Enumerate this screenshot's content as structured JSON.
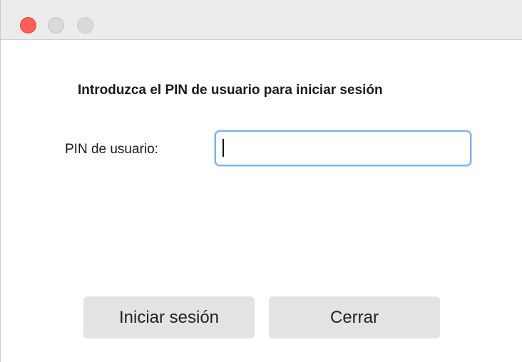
{
  "window": {
    "traffic_lights": {
      "close_color": "#fe5f57",
      "minimize_color": "#d9d9d9",
      "zoom_color": "#d9d9d9"
    }
  },
  "dialog": {
    "heading": "Introduzca el PIN de usuario para iniciar sesión",
    "pin_label": "PIN de usuario:",
    "pin_value": "",
    "login_button": "Iniciar sesión",
    "close_button": "Cerrar"
  }
}
